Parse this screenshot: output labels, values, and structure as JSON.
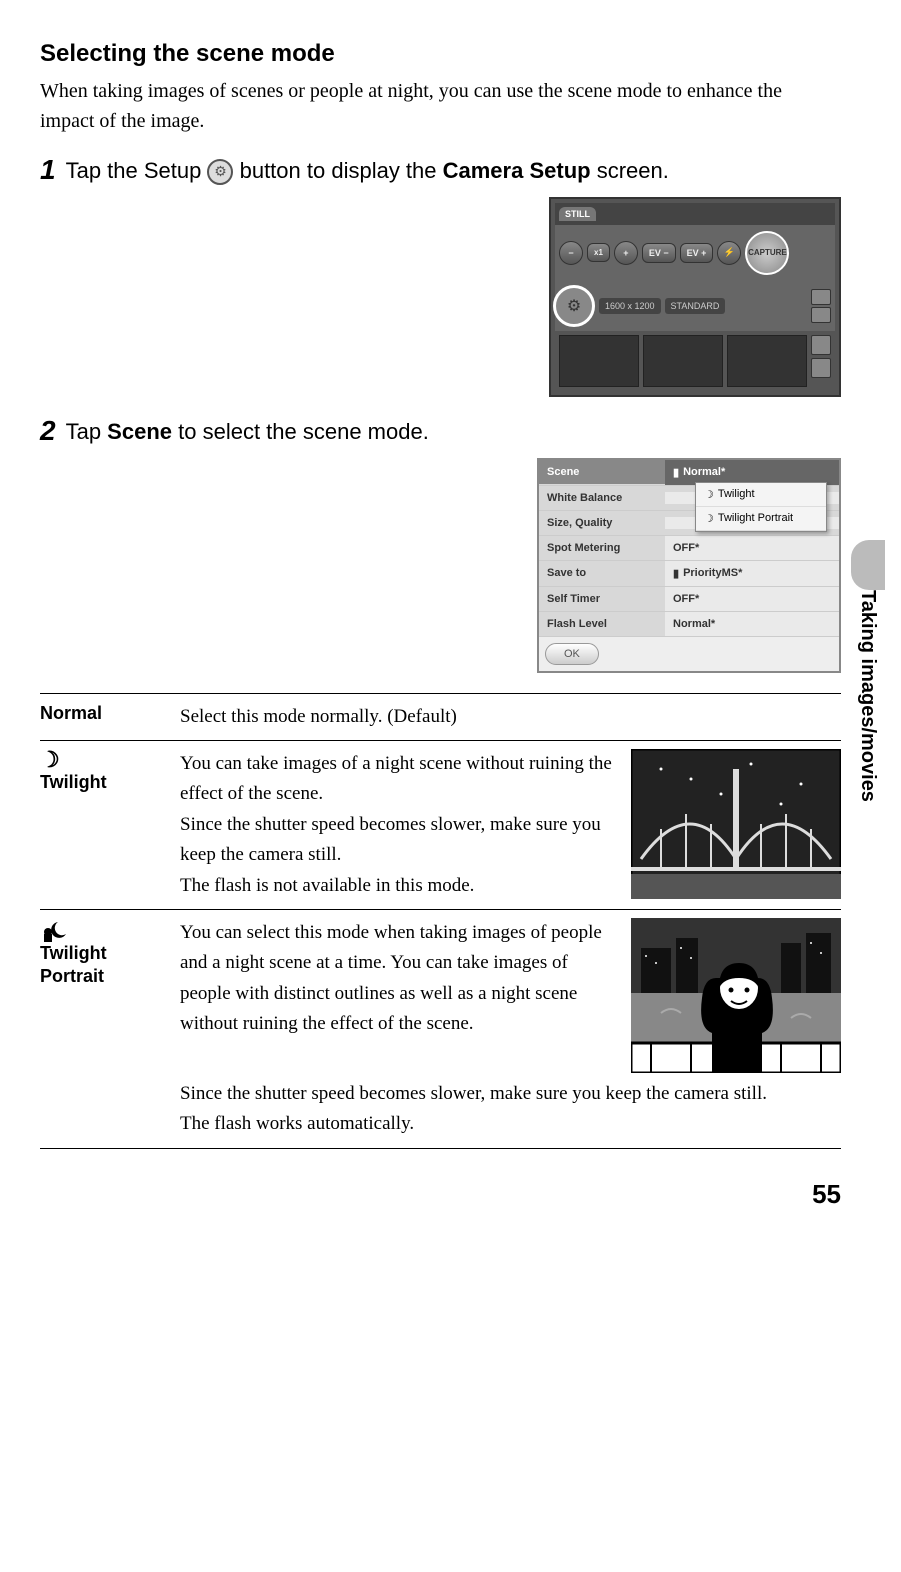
{
  "title": "Selecting the scene mode",
  "intro": "When taking images of scenes or people at night, you can use the scene mode to enhance the impact of the image.",
  "steps": {
    "s1": {
      "num": "1",
      "pre": "Tap the Setup ",
      "post": " button to display the ",
      "bold": "Camera Setup",
      "tail": " screen."
    },
    "s2": {
      "num": "2",
      "pre": "Tap ",
      "bold": "Scene",
      "post": " to select the scene mode."
    }
  },
  "camera": {
    "tab": "STILL",
    "zoom": "ZOOM",
    "evm": "EV −",
    "evp": "EV +",
    "capture": "CAPTURE",
    "res": "1600 x 1200",
    "quality": "STANDARD"
  },
  "settings": {
    "rows": [
      {
        "label": "Scene",
        "value": "Normal*"
      },
      {
        "label": "White Balance",
        "value": ""
      },
      {
        "label": "Size, Quality",
        "value": ""
      },
      {
        "label": "Spot Metering",
        "value": "OFF*"
      },
      {
        "label": "Save to",
        "value": "PriorityMS*"
      },
      {
        "label": "Self Timer",
        "value": "OFF*"
      },
      {
        "label": "Flash Level",
        "value": "Normal*"
      }
    ],
    "dropdown": {
      "opt1": "Twilight",
      "opt2": "Twilight Portrait"
    },
    "ok": "OK"
  },
  "modes": {
    "normal": {
      "label": "Normal",
      "desc": "Select this mode normally. (Default)"
    },
    "twilight": {
      "label": "Twilight",
      "desc": "You can take images of a night scene without ruining the effect of the scene.\nSince the shutter speed becomes slower, make sure you keep the camera still.\nThe flash is not available in this mode."
    },
    "twilight_portrait": {
      "label": "Twilight Portrait",
      "desc_top": "You can select this mode when taking images of people and a night scene at a time. You can take images of people with distinct outlines as well as a night scene without ruining the effect of the scene.",
      "desc_bottom": "Since the shutter speed becomes slower, make sure you keep the camera still.\nThe flash works automatically."
    }
  },
  "side_tab": "Taking images/movies",
  "page_number": "55"
}
